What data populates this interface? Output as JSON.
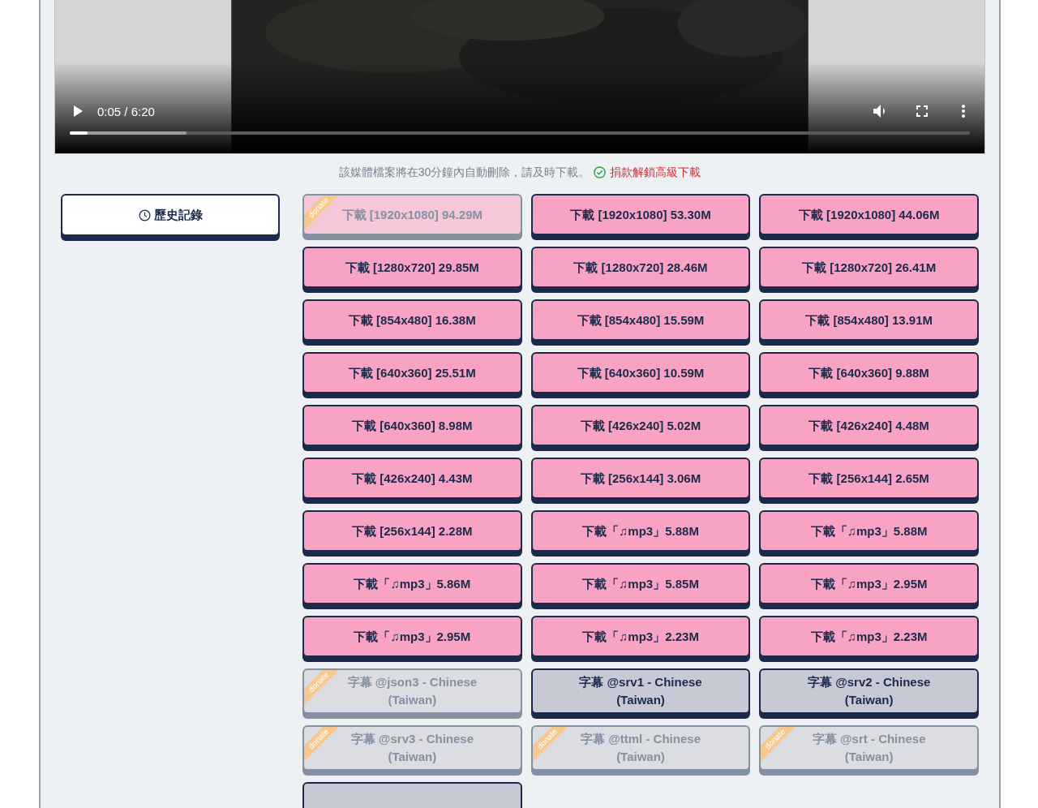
{
  "video": {
    "time": "0:05 / 6:20",
    "level": 0.02
  },
  "notice": {
    "text": "該媒體檔案將在30分鐘內自動刪除，請及時下載。",
    "link": "捐款解鎖高級下載"
  },
  "history_button": "歷史記錄",
  "downloads": [
    {
      "kind": "video",
      "label": "下載 [1920x1080] 94.29M",
      "disabled": true,
      "ribbon": "donate"
    },
    {
      "kind": "video",
      "label": "下載 [1920x1080] 53.30M",
      "disabled": false
    },
    {
      "kind": "video",
      "label": "下載 [1920x1080] 44.06M",
      "disabled": false
    },
    {
      "kind": "video",
      "label": "下載 [1280x720] 29.85M",
      "disabled": false
    },
    {
      "kind": "video",
      "label": "下載 [1280x720] 28.46M",
      "disabled": false
    },
    {
      "kind": "video",
      "label": "下載 [1280x720] 26.41M",
      "disabled": false
    },
    {
      "kind": "video",
      "label": "下載 [854x480] 16.38M",
      "disabled": false
    },
    {
      "kind": "video",
      "label": "下載 [854x480] 15.59M",
      "disabled": false
    },
    {
      "kind": "video",
      "label": "下載 [854x480] 13.91M",
      "disabled": false
    },
    {
      "kind": "video",
      "label": "下載 [640x360] 25.51M",
      "disabled": false
    },
    {
      "kind": "video",
      "label": "下載 [640x360] 10.59M",
      "disabled": false
    },
    {
      "kind": "video",
      "label": "下載 [640x360] 9.88M",
      "disabled": false
    },
    {
      "kind": "video",
      "label": "下載 [640x360] 8.98M",
      "disabled": false
    },
    {
      "kind": "video",
      "label": "下載 [426x240] 5.02M",
      "disabled": false
    },
    {
      "kind": "video",
      "label": "下載 [426x240] 4.48M",
      "disabled": false
    },
    {
      "kind": "video",
      "label": "下載 [426x240] 4.43M",
      "disabled": false
    },
    {
      "kind": "video",
      "label": "下載 [256x144] 3.06M",
      "disabled": false
    },
    {
      "kind": "video",
      "label": "下載 [256x144] 2.65M",
      "disabled": false
    },
    {
      "kind": "video",
      "label": "下載 [256x144] 2.28M",
      "disabled": false
    },
    {
      "kind": "video",
      "label": "下載「♫mp3」5.88M",
      "disabled": false
    },
    {
      "kind": "video",
      "label": "下載「♫mp3」5.88M",
      "disabled": false
    },
    {
      "kind": "video",
      "label": "下載「♫mp3」5.86M",
      "disabled": false
    },
    {
      "kind": "video",
      "label": "下載「♫mp3」5.85M",
      "disabled": false
    },
    {
      "kind": "video",
      "label": "下載「♫mp3」2.95M",
      "disabled": false
    },
    {
      "kind": "video",
      "label": "下載「♫mp3」2.95M",
      "disabled": false
    },
    {
      "kind": "video",
      "label": "下載「♫mp3」2.23M",
      "disabled": false
    },
    {
      "kind": "video",
      "label": "下載「♫mp3」2.23M",
      "disabled": false
    },
    {
      "kind": "subtitle",
      "label": "字幕 @json3 - Chinese (Taiwan)",
      "disabled": true,
      "ribbon": "donate"
    },
    {
      "kind": "subtitle",
      "label": "字幕 @srv1 - Chinese (Taiwan)",
      "disabled": false
    },
    {
      "kind": "subtitle",
      "label": "字幕 @srv2 - Chinese (Taiwan)",
      "disabled": false
    },
    {
      "kind": "subtitle",
      "label": "字幕 @srv3 - Chinese (Taiwan)",
      "disabled": true,
      "ribbon": "donate"
    },
    {
      "kind": "subtitle",
      "label": "字幕 @ttml - Chinese (Taiwan)",
      "disabled": true,
      "ribbon": "donate"
    },
    {
      "kind": "subtitle",
      "label": "字幕 @srt - Chinese (Taiwan)",
      "disabled": true,
      "ribbon": "donate"
    },
    {
      "kind": "subtitle",
      "disabled": false
    }
  ]
}
